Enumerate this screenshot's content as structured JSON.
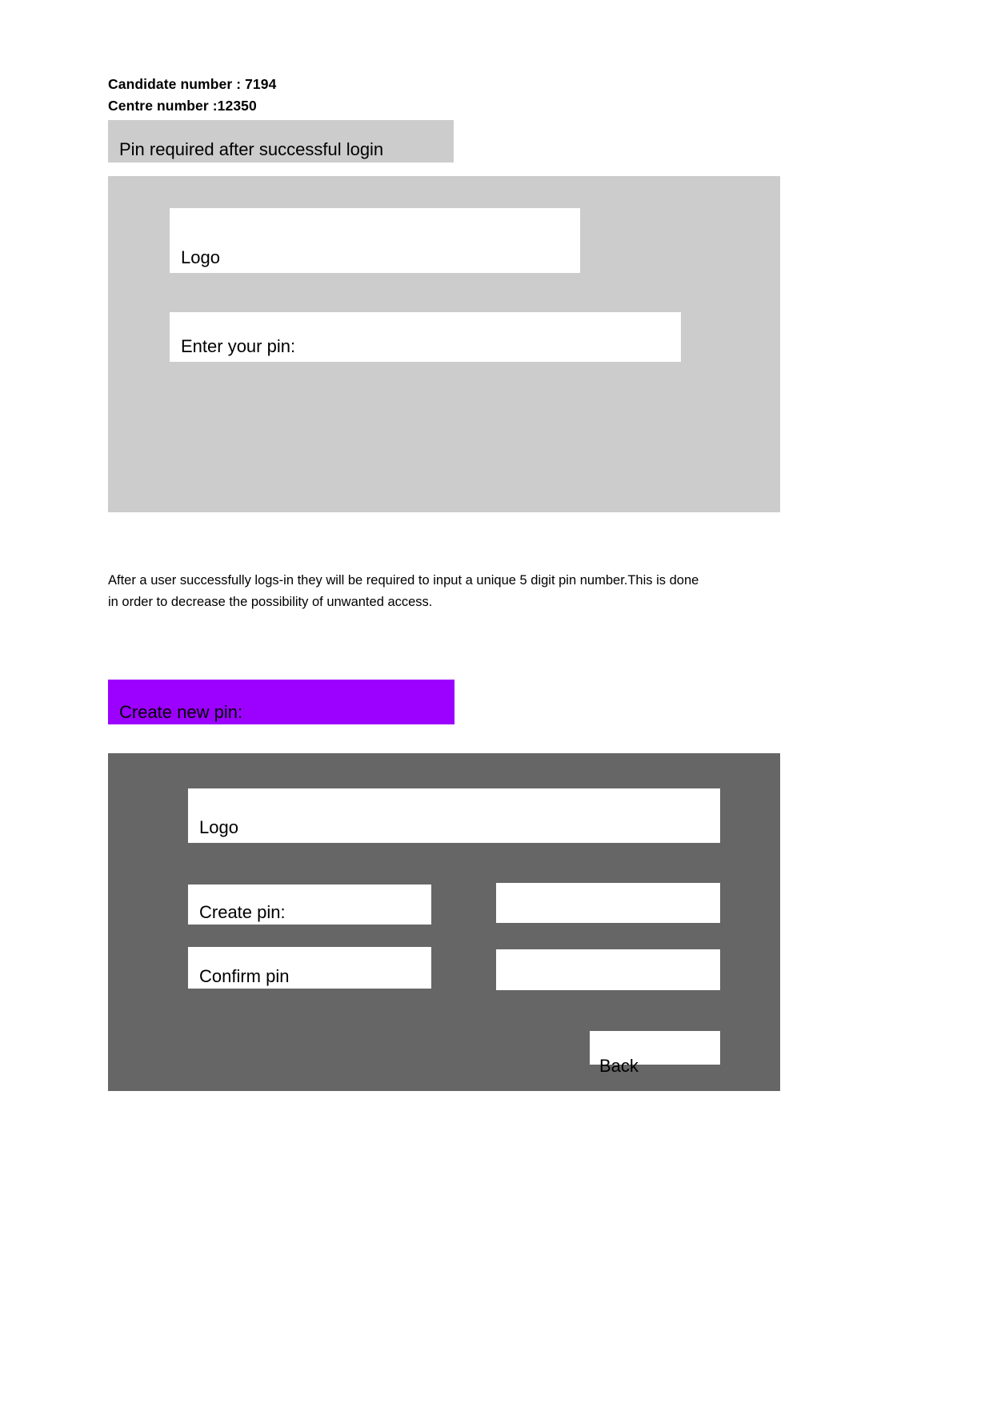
{
  "header": {
    "candidate_line": "Candidate number : 7194",
    "centre_line": "Centre number :12350"
  },
  "section_one": {
    "title": "Pin required after successful login",
    "logo_label": "Logo",
    "pin_label": "Enter your pin:"
  },
  "description": {
    "text": "After a user successfully logs-in they will be required to input a unique 5 digit pin number.This is done in order to decrease the possibility of unwanted access."
  },
  "section_two": {
    "title": "Create new pin:",
    "logo_label": "Logo",
    "create_pin_label": "Create pin:",
    "confirm_pin_label": "Confirm pin",
    "create_pin_value": "",
    "confirm_pin_value": "",
    "back_label": "Back"
  },
  "colors": {
    "light_panel": "#cccccc",
    "dark_panel": "#666666",
    "accent_purple": "#9c00ff",
    "box_fill": "#ffffff",
    "text": "#000000"
  }
}
